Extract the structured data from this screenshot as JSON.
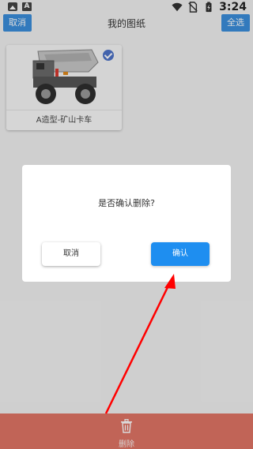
{
  "status_bar": {
    "time": "3:24",
    "left_icons": [
      "image-icon",
      "font-a-icon"
    ],
    "right_icons": [
      "wifi-icon",
      "no-sim-icon",
      "battery-icon"
    ]
  },
  "app_bar": {
    "cancel_label": "取消",
    "title": "我的图纸",
    "select_all_label": "全选"
  },
  "card": {
    "label": "A造型-矿山卡车",
    "selected": true
  },
  "dialog": {
    "message": "是否确认删除?",
    "cancel_label": "取消",
    "confirm_label": "确认"
  },
  "bottom_bar": {
    "delete_label": "删除"
  },
  "colors": {
    "primary": "#1e8ef0",
    "app_bar_button": "#3b8fdc",
    "delete_bar": "#e17566",
    "check": "#4f74c9",
    "arrow": "#ff0000"
  }
}
